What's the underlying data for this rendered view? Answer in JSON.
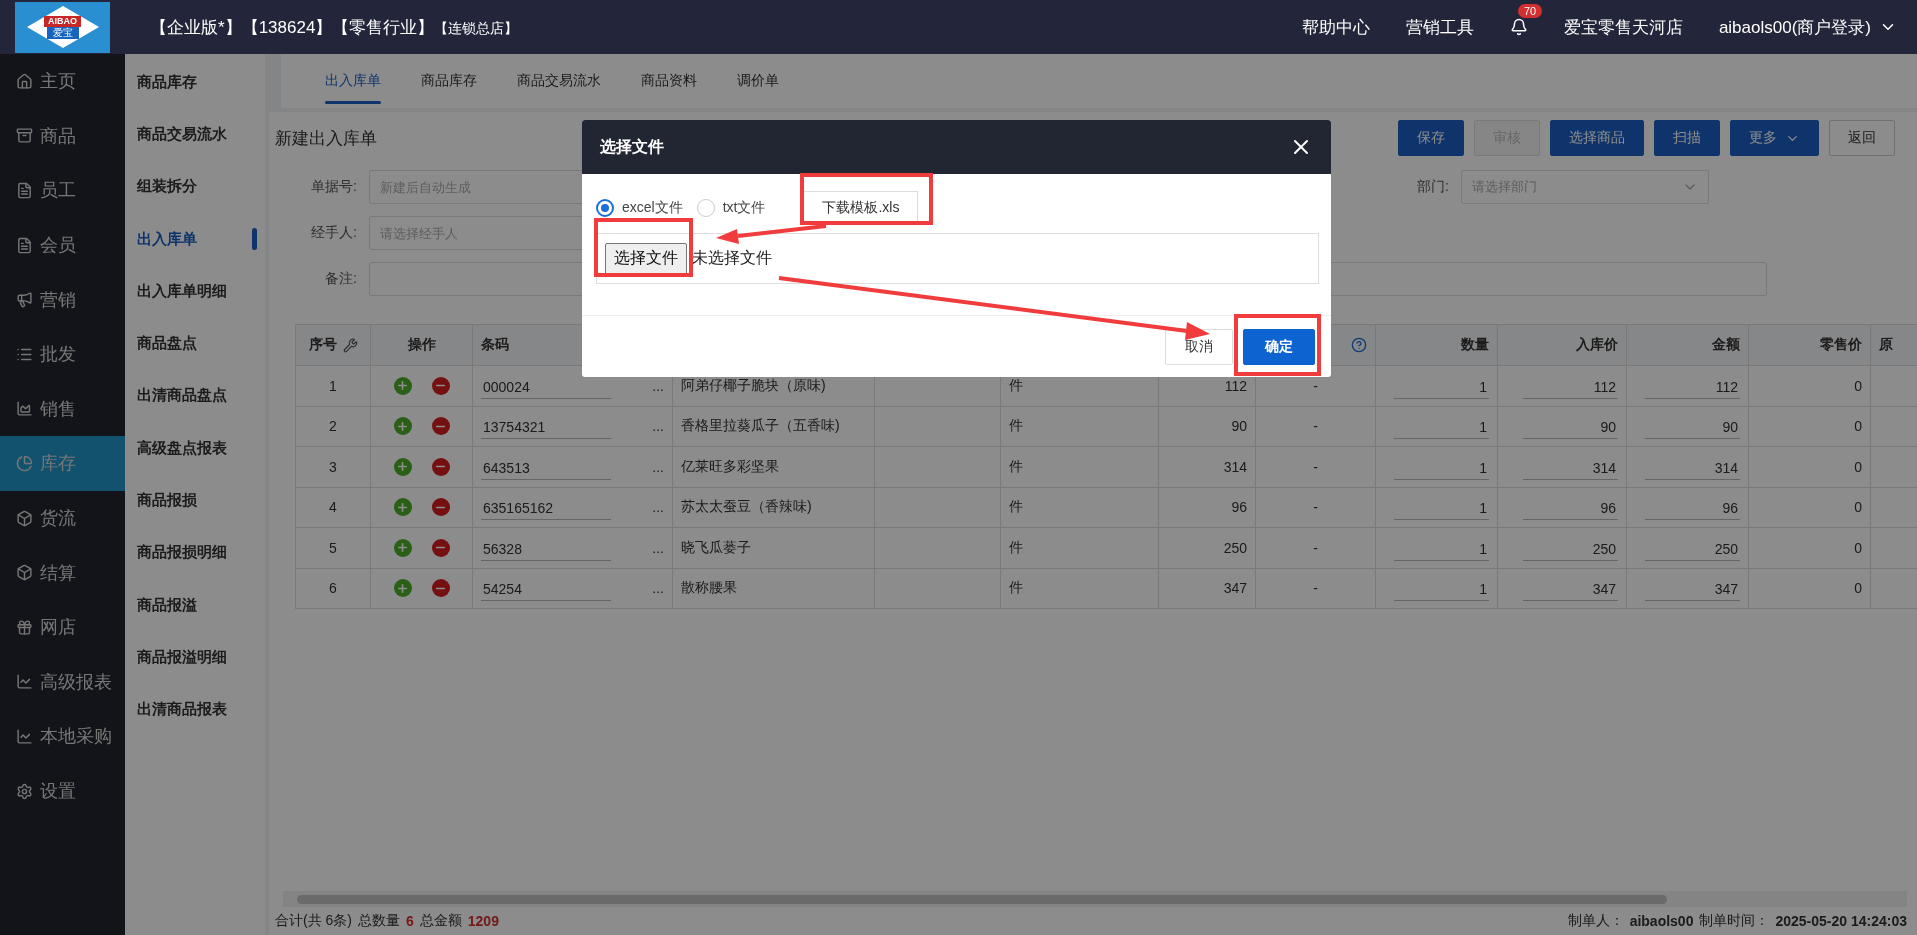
{
  "header": {
    "logo": {
      "brand": "AIBAO",
      "mark": "爱宝"
    },
    "tags": [
      "【企业版*】",
      "【138624】",
      "【零售行业】"
    ],
    "store_tag": "【连锁总店】",
    "links": [
      "帮助中心",
      "营销工具"
    ],
    "notifications": "70",
    "store": "爱宝零售天河店",
    "user": "aibaols00(商户登录)"
  },
  "sidebar": {
    "items": [
      {
        "label": "主页",
        "selected": false
      },
      {
        "label": "商品",
        "selected": false
      },
      {
        "label": "员工",
        "selected": false
      },
      {
        "label": "会员",
        "selected": false
      },
      {
        "label": "营销",
        "selected": false
      },
      {
        "label": "批发",
        "selected": false
      },
      {
        "label": "销售",
        "selected": false
      },
      {
        "label": "库存",
        "selected": true
      },
      {
        "label": "货流",
        "selected": false
      },
      {
        "label": "结算",
        "selected": false
      },
      {
        "label": "网店",
        "selected": false
      },
      {
        "label": "高级报表",
        "selected": false
      },
      {
        "label": "本地采购",
        "selected": false
      },
      {
        "label": "设置",
        "selected": false
      }
    ]
  },
  "submenu": {
    "items": [
      {
        "label": "商品库存",
        "selected": false
      },
      {
        "label": "商品交易流水",
        "selected": false
      },
      {
        "label": "组装拆分",
        "selected": false
      },
      {
        "label": "出入库单",
        "selected": true
      },
      {
        "label": "出入库单明细",
        "selected": false
      },
      {
        "label": "商品盘点",
        "selected": false
      },
      {
        "label": "出清商品盘点",
        "selected": false
      },
      {
        "label": "高级盘点报表",
        "selected": false
      },
      {
        "label": "商品报损",
        "selected": false
      },
      {
        "label": "商品报损明细",
        "selected": false
      },
      {
        "label": "商品报溢",
        "selected": false
      },
      {
        "label": "商品报溢明细",
        "selected": false
      },
      {
        "label": "出清商品报表",
        "selected": false
      }
    ]
  },
  "tabs": [
    {
      "label": "出入库单",
      "selected": true
    },
    {
      "label": "商品库存",
      "selected": false
    },
    {
      "label": "商品交易流水",
      "selected": false
    },
    {
      "label": "商品资料",
      "selected": false
    },
    {
      "label": "调价单",
      "selected": false
    }
  ],
  "page_title": "新建出入库单",
  "toolbar": {
    "buttons": [
      {
        "label": "保存",
        "kind": "primary",
        "disabled": false
      },
      {
        "label": "审核",
        "kind": "primary",
        "disabled": true
      },
      {
        "label": "选择商品",
        "kind": "primary",
        "disabled": false
      },
      {
        "label": "扫描",
        "kind": "primary",
        "disabled": false
      },
      {
        "label": "更多",
        "kind": "menu",
        "disabled": false
      },
      {
        "label": "返回",
        "kind": "default",
        "disabled": false
      }
    ]
  },
  "form": {
    "fields": [
      {
        "label": "单据号:",
        "placeholder": "新建后自动生成",
        "kind": "text"
      },
      {
        "label": "部门:",
        "placeholder": "请选择部门",
        "kind": "select"
      },
      {
        "label": "经手人:",
        "placeholder": "请选择经手人",
        "kind": "text"
      },
      {
        "label": "备注:",
        "kind": "wide"
      }
    ]
  },
  "table": {
    "columns": [
      {
        "label": "序号",
        "kind": "settings"
      },
      {
        "label": "操作"
      },
      {
        "label": "条码"
      },
      {},
      {},
      {},
      {},
      {
        "kind": "help"
      },
      {
        "label": "数量"
      },
      {
        "label": "入库价"
      },
      {
        "label": "金额"
      },
      {
        "label": "零售价"
      },
      {
        "label": "原"
      }
    ],
    "rows": [
      {
        "seq": "1",
        "barcode": "000024",
        "picker": "...",
        "name": "阿弟仔椰子脆块（原味)",
        "unit": "件",
        "column_7": "112",
        "column_8": "-",
        "qty": "1",
        "price": "112",
        "amount": "112",
        "retail": "0"
      },
      {
        "seq": "2",
        "barcode": "13754321",
        "picker": "...",
        "name": "香格里拉葵瓜子（五香味)",
        "unit": "件",
        "column_7": "90",
        "column_8": "-",
        "qty": "1",
        "price": "90",
        "amount": "90",
        "retail": "0"
      },
      {
        "seq": "3",
        "barcode": "643513",
        "picker": "...",
        "name": "亿莱旺多彩坚果",
        "unit": "件",
        "column_7": "314",
        "column_8": "-",
        "qty": "1",
        "price": "314",
        "amount": "314",
        "retail": "0"
      },
      {
        "seq": "4",
        "barcode": "635165162",
        "picker": "...",
        "name": "苏太太蚕豆（香辣味)",
        "unit": "件",
        "column_7": "96",
        "column_8": "-",
        "qty": "1",
        "price": "96",
        "amount": "96",
        "retail": "0"
      },
      {
        "seq": "5",
        "barcode": "56328",
        "picker": "...",
        "name": "晓飞瓜蒌子",
        "unit": "件",
        "column_7": "250",
        "column_8": "-",
        "qty": "1",
        "price": "250",
        "amount": "250",
        "retail": "0"
      },
      {
        "seq": "6",
        "barcode": "54254",
        "picker": "...",
        "name": "散称腰果",
        "unit": "件",
        "column_7": "347",
        "column_8": "-",
        "qty": "1",
        "price": "347",
        "amount": "347",
        "retail": "0"
      }
    ]
  },
  "footer": {
    "count": "合计(共 6条)",
    "qty_label": "总数量",
    "qty": "6",
    "amount_label": "总金额",
    "amount": "1209",
    "maker_label": "制单人：",
    "maker": "aibaols00",
    "time_label": "制单时间：",
    "time": "2025-05-20 14:24:03"
  },
  "dialog": {
    "title": "选择文件",
    "radios": [
      {
        "label": "excel文件",
        "selected": true
      },
      {
        "label": "txt文件",
        "selected": false
      }
    ],
    "template_button": "下载模板.xls",
    "file_button": "选择文件",
    "file_status": "未选择文件",
    "buttons": [
      {
        "label": "取消",
        "kind": "default"
      },
      {
        "label": "确定",
        "kind": "primary"
      }
    ]
  }
}
